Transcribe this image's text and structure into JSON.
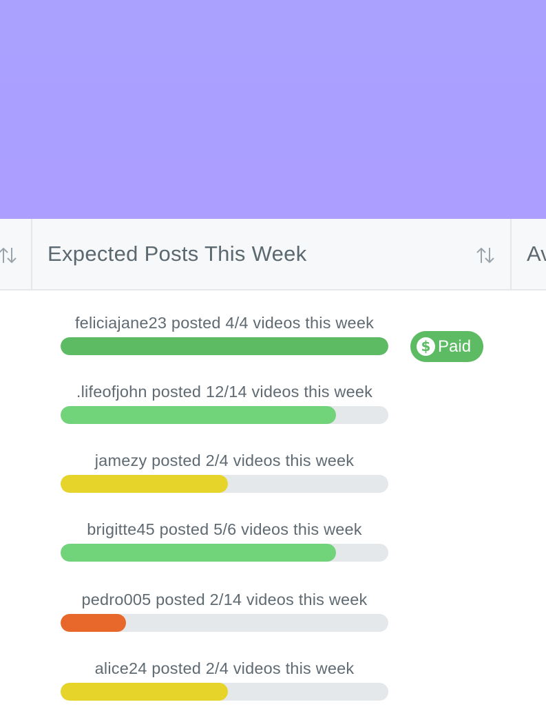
{
  "header": {
    "column_title": "Expected Posts This Week",
    "next_column_title": "Av",
    "sort_icon": "sort-arrows-icon"
  },
  "rows": [
    {
      "label": "feliciajane23 posted 4/4 videos this week",
      "progress": 1.0,
      "color": "#5dbb63"
    },
    {
      "label": ".lifeofjohn posted 12/14 videos this week",
      "progress": 0.84,
      "color": "#72d47a"
    },
    {
      "label": "jamezy posted 2/4 videos this week",
      "progress": 0.51,
      "color": "#e6d42a"
    },
    {
      "label": "brigitte45 posted 5/6 videos this week",
      "progress": 0.84,
      "color": "#72d47a"
    },
    {
      "label": "pedro005 posted 2/14 videos this week",
      "progress": 0.2,
      "color": "#e8672a"
    },
    {
      "label": "alice24 posted 2/4 videos this week",
      "progress": 0.51,
      "color": "#e6d42a"
    }
  ],
  "badge": {
    "label": "Paid",
    "icon": "dollar-icon",
    "icon_glyph": "$",
    "color": "#5dbb63"
  }
}
